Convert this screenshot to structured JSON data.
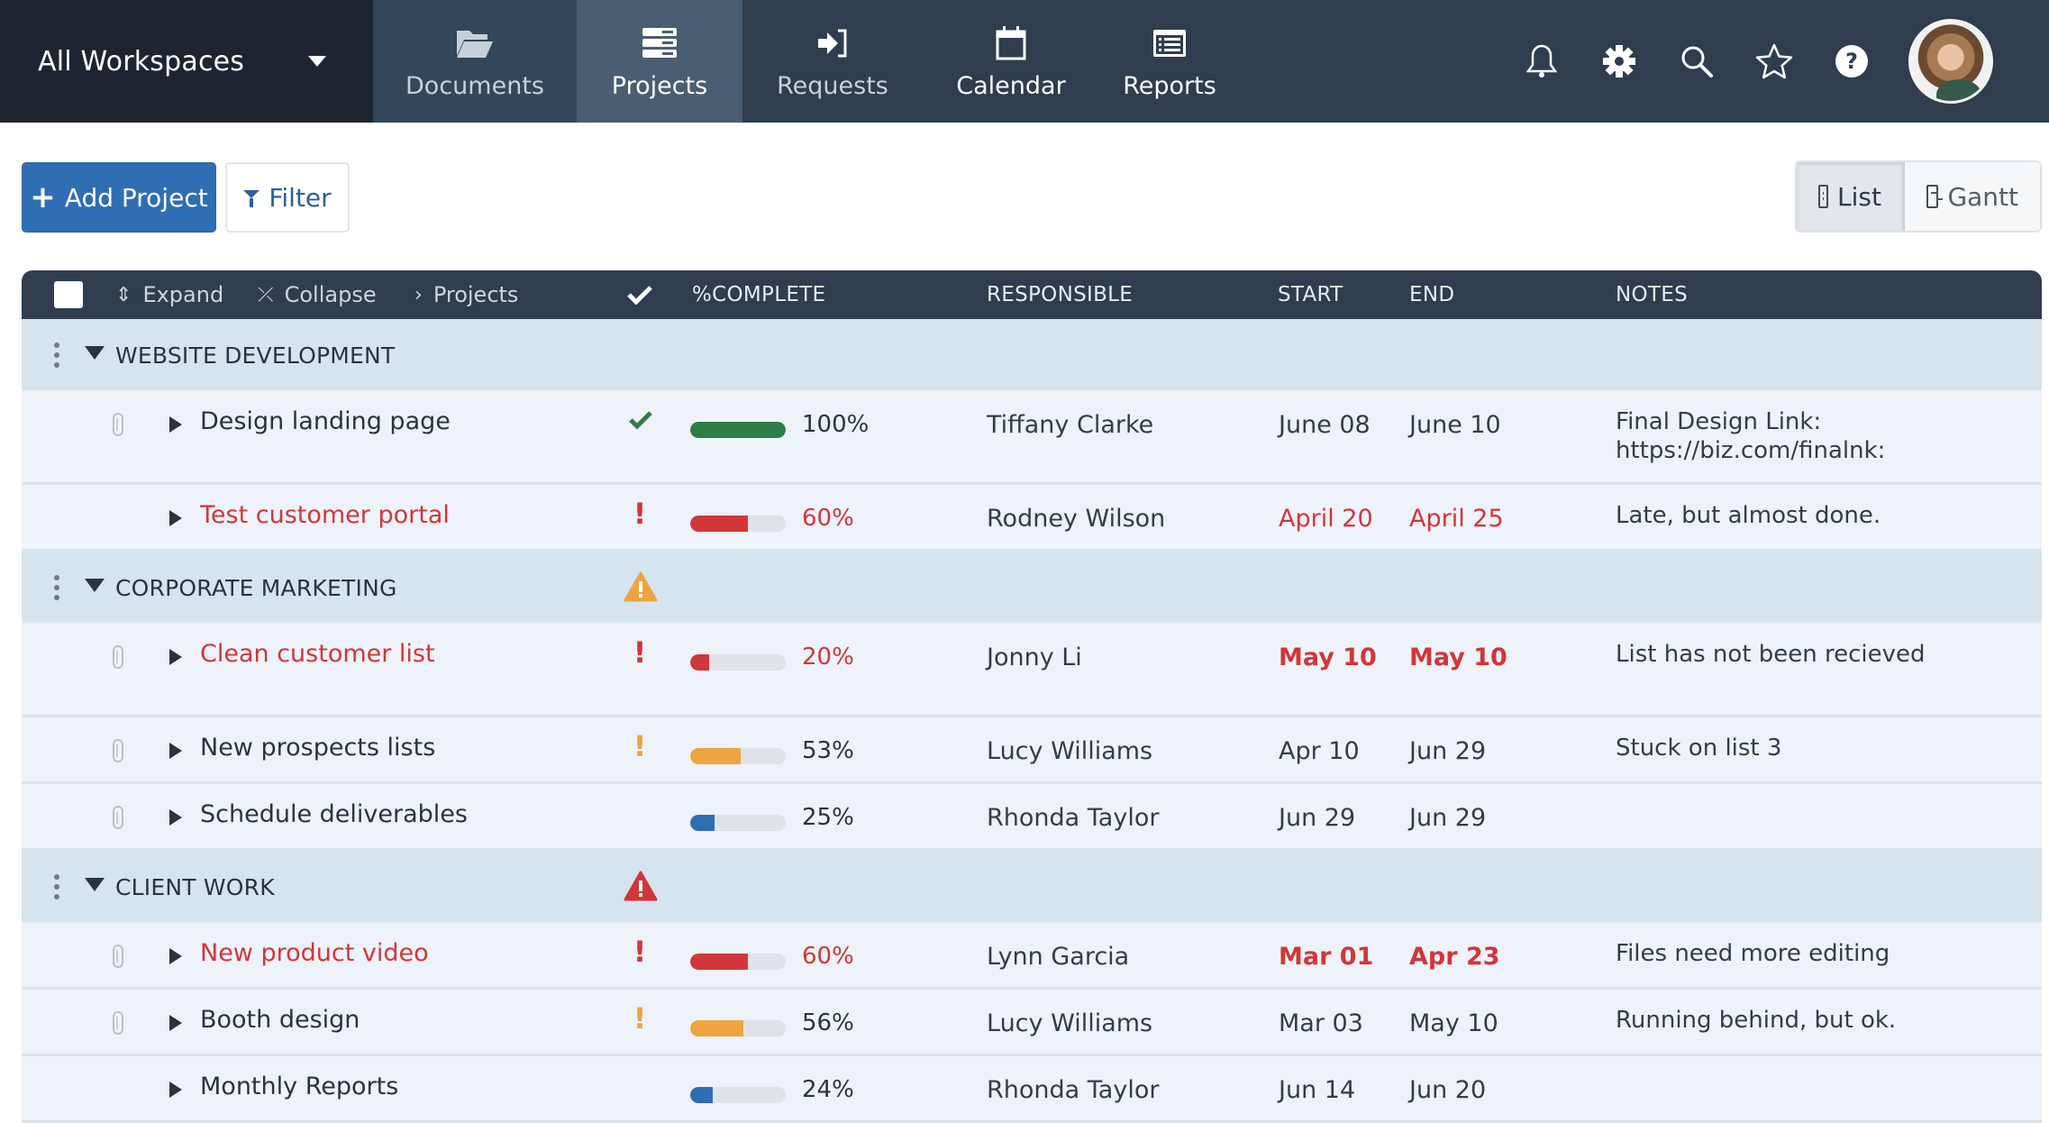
{
  "topnav": {
    "workspace_label": "All Workspaces",
    "tabs": [
      {
        "label": "Documents",
        "icon": "folder-open-icon",
        "active": false
      },
      {
        "label": "Projects",
        "icon": "tasks-icon",
        "active": true
      },
      {
        "label": "Requests",
        "icon": "sign-in-icon",
        "active": false
      },
      {
        "label": "Calendar",
        "icon": "calendar-icon",
        "active": false
      },
      {
        "label": "Reports",
        "icon": "list-alt-icon",
        "active": false
      }
    ],
    "right_icons": [
      "bell-icon",
      "gear-icon",
      "search-icon",
      "star-icon",
      "help-icon"
    ],
    "avatar": "user-avatar"
  },
  "toolbar": {
    "add_label": "Add Project",
    "filter_label": "Filter",
    "view_list_label": "List",
    "view_gantt_label": "Gantt",
    "active_view": "List"
  },
  "table": {
    "header": {
      "expand": "Expand",
      "collapse": "Collapse",
      "projects": "Projects",
      "complete": "%COMPLETE",
      "responsible": "RESPONSIBLE",
      "start": "START",
      "end": "END",
      "notes": "NOTES"
    },
    "groups": [
      {
        "title": "WEBSITE DEVELOPMENT",
        "warning": null,
        "tasks": [
          {
            "name": "Design landing page",
            "status": "done",
            "percent": 100,
            "percent_label": "100%",
            "responsible": "Tiffany Clarke",
            "start": "June 08",
            "end": "June 10",
            "notes": "Final Design Link: https://biz.com/finalnk:",
            "attachment": true,
            "late": false
          },
          {
            "name": "Test customer portal",
            "status": "critical",
            "percent": 60,
            "percent_label": "60%",
            "responsible": "Rodney Wilson",
            "start": "April 20",
            "end": "April 25",
            "notes": "Late, but almost done.",
            "attachment": false,
            "late": true
          }
        ]
      },
      {
        "title": "CORPORATE MARKETING",
        "warning": "warning",
        "tasks": [
          {
            "name": "Clean customer list",
            "status": "critical",
            "percent": 20,
            "percent_label": "20%",
            "responsible": "Jonny Li",
            "start": "May 10",
            "end": "May 10",
            "notes": "List has not been recieved",
            "attachment": true,
            "late": true
          },
          {
            "name": "New prospects lists",
            "status": "warning",
            "percent": 53,
            "percent_label": "53%",
            "responsible": "Lucy Williams",
            "start": "Apr 10",
            "end": "Jun 29",
            "notes": "Stuck on list 3",
            "attachment": true,
            "late": false
          },
          {
            "name": "Schedule deliverables",
            "status": "normal",
            "percent": 25,
            "percent_label": "25%",
            "responsible": "Rhonda Taylor",
            "start": "Jun 29",
            "end": "Jun 29",
            "notes": "",
            "attachment": true,
            "late": false
          }
        ]
      },
      {
        "title": "CLIENT WORK",
        "warning": "critical",
        "tasks": [
          {
            "name": "New product video",
            "status": "critical",
            "percent": 60,
            "percent_label": "60%",
            "responsible": "Lynn Garcia",
            "start": "Mar 01",
            "end": "Apr 23",
            "notes": "Files need more editing",
            "attachment": true,
            "late": true
          },
          {
            "name": "Booth design",
            "status": "warning",
            "percent": 56,
            "percent_label": "56%",
            "responsible": "Lucy Williams",
            "start": "Mar 03",
            "end": "May 10",
            "notes": "Running behind, but ok.",
            "attachment": true,
            "late": false
          },
          {
            "name": "Monthly Reports",
            "status": "normal",
            "percent": 24,
            "percent_label": "24%",
            "responsible": "Rhonda Taylor",
            "start": "Jun 14",
            "end": "Jun 20",
            "notes": "",
            "attachment": false,
            "late": false
          }
        ]
      }
    ]
  },
  "colors": {
    "nav_bg": "#2f3d4f",
    "workspace_bg": "#1e2530",
    "accent_blue": "#2f6eb3",
    "done_green": "#2e7d45",
    "critical_red": "#d2363a",
    "warning_orange": "#eea440",
    "normal_blue": "#2f6eb3",
    "group_bg": "#d5e4ee",
    "row_bg": "#eef3f9"
  }
}
